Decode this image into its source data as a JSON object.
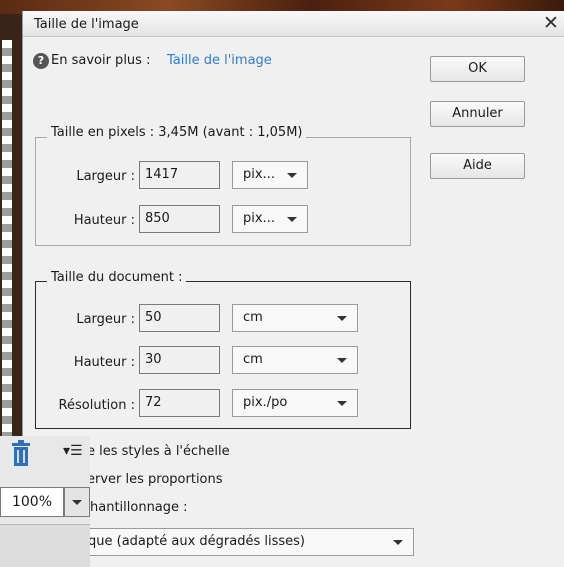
{
  "dialog": {
    "title": "Taille de l'image",
    "help_prefix": "En savoir plus :",
    "help_link": "Taille de l'image"
  },
  "buttons": {
    "ok": "OK",
    "cancel": "Annuler",
    "help": "Aide"
  },
  "pixel_size": {
    "legend": "Taille en pixels : 3,45M (avant : 1,05M)",
    "width_label": "Largeur :",
    "width_value": "1417",
    "width_unit": "pix...",
    "height_label": "Hauteur :",
    "height_value": "850",
    "height_unit": "pix..."
  },
  "document_size": {
    "legend": "Taille du document :",
    "width_label": "Largeur :",
    "width_value": "50",
    "width_unit": "cm",
    "height_label": "Hauteur :",
    "height_value": "30",
    "height_unit": "cm",
    "resolution_label": "Résolution :",
    "resolution_value": "72",
    "resolution_unit": "pix./po"
  },
  "options": {
    "scale_styles": "e les styles à l'échelle",
    "constrain_proportions": "erver les proportions",
    "resample": "hantillonnage :",
    "resample_method": "que (adapté aux dégradés lisses)"
  },
  "panel": {
    "zoom": "100%"
  }
}
